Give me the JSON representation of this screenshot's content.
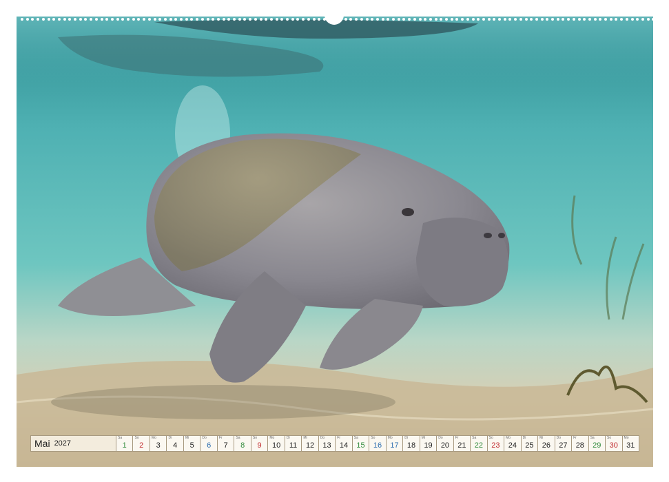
{
  "calendar": {
    "month": "Mai",
    "year": "2027",
    "days": [
      {
        "num": "1",
        "weekday": "Sa",
        "kind": "sat"
      },
      {
        "num": "2",
        "weekday": "So",
        "kind": "sun"
      },
      {
        "num": "3",
        "weekday": "Mo",
        "kind": "wk"
      },
      {
        "num": "4",
        "weekday": "Di",
        "kind": "wk"
      },
      {
        "num": "5",
        "weekday": "Mi",
        "kind": "wk"
      },
      {
        "num": "6",
        "weekday": "Do",
        "kind": "blue"
      },
      {
        "num": "7",
        "weekday": "Fr",
        "kind": "wk"
      },
      {
        "num": "8",
        "weekday": "Sa",
        "kind": "sat"
      },
      {
        "num": "9",
        "weekday": "So",
        "kind": "sun"
      },
      {
        "num": "10",
        "weekday": "Mo",
        "kind": "wk"
      },
      {
        "num": "11",
        "weekday": "Di",
        "kind": "wk"
      },
      {
        "num": "12",
        "weekday": "Mi",
        "kind": "wk"
      },
      {
        "num": "13",
        "weekday": "Do",
        "kind": "wk"
      },
      {
        "num": "14",
        "weekday": "Fr",
        "kind": "wk"
      },
      {
        "num": "15",
        "weekday": "Sa",
        "kind": "sat"
      },
      {
        "num": "16",
        "weekday": "So",
        "kind": "blue"
      },
      {
        "num": "17",
        "weekday": "Mo",
        "kind": "blue"
      },
      {
        "num": "18",
        "weekday": "Di",
        "kind": "wk"
      },
      {
        "num": "19",
        "weekday": "Mi",
        "kind": "wk"
      },
      {
        "num": "20",
        "weekday": "Do",
        "kind": "wk"
      },
      {
        "num": "21",
        "weekday": "Fr",
        "kind": "wk"
      },
      {
        "num": "22",
        "weekday": "Sa",
        "kind": "sat"
      },
      {
        "num": "23",
        "weekday": "So",
        "kind": "sun"
      },
      {
        "num": "24",
        "weekday": "Mo",
        "kind": "wk"
      },
      {
        "num": "25",
        "weekday": "Di",
        "kind": "wk"
      },
      {
        "num": "26",
        "weekday": "Mi",
        "kind": "wk"
      },
      {
        "num": "27",
        "weekday": "Do",
        "kind": "wk"
      },
      {
        "num": "28",
        "weekday": "Fr",
        "kind": "wk"
      },
      {
        "num": "29",
        "weekday": "Sa",
        "kind": "sat"
      },
      {
        "num": "30",
        "weekday": "So",
        "kind": "sun"
      },
      {
        "num": "31",
        "weekday": "Mo",
        "kind": "wk"
      }
    ]
  },
  "colors": {
    "water_top": "#3a9a9c",
    "water_mid": "#58bcbc",
    "sand": "#cdbd9c",
    "manatee": "#8e8c92",
    "sunday": "#c0262a",
    "saturday": "#2f8a3a",
    "holiday_blue": "#2f6fb0"
  }
}
